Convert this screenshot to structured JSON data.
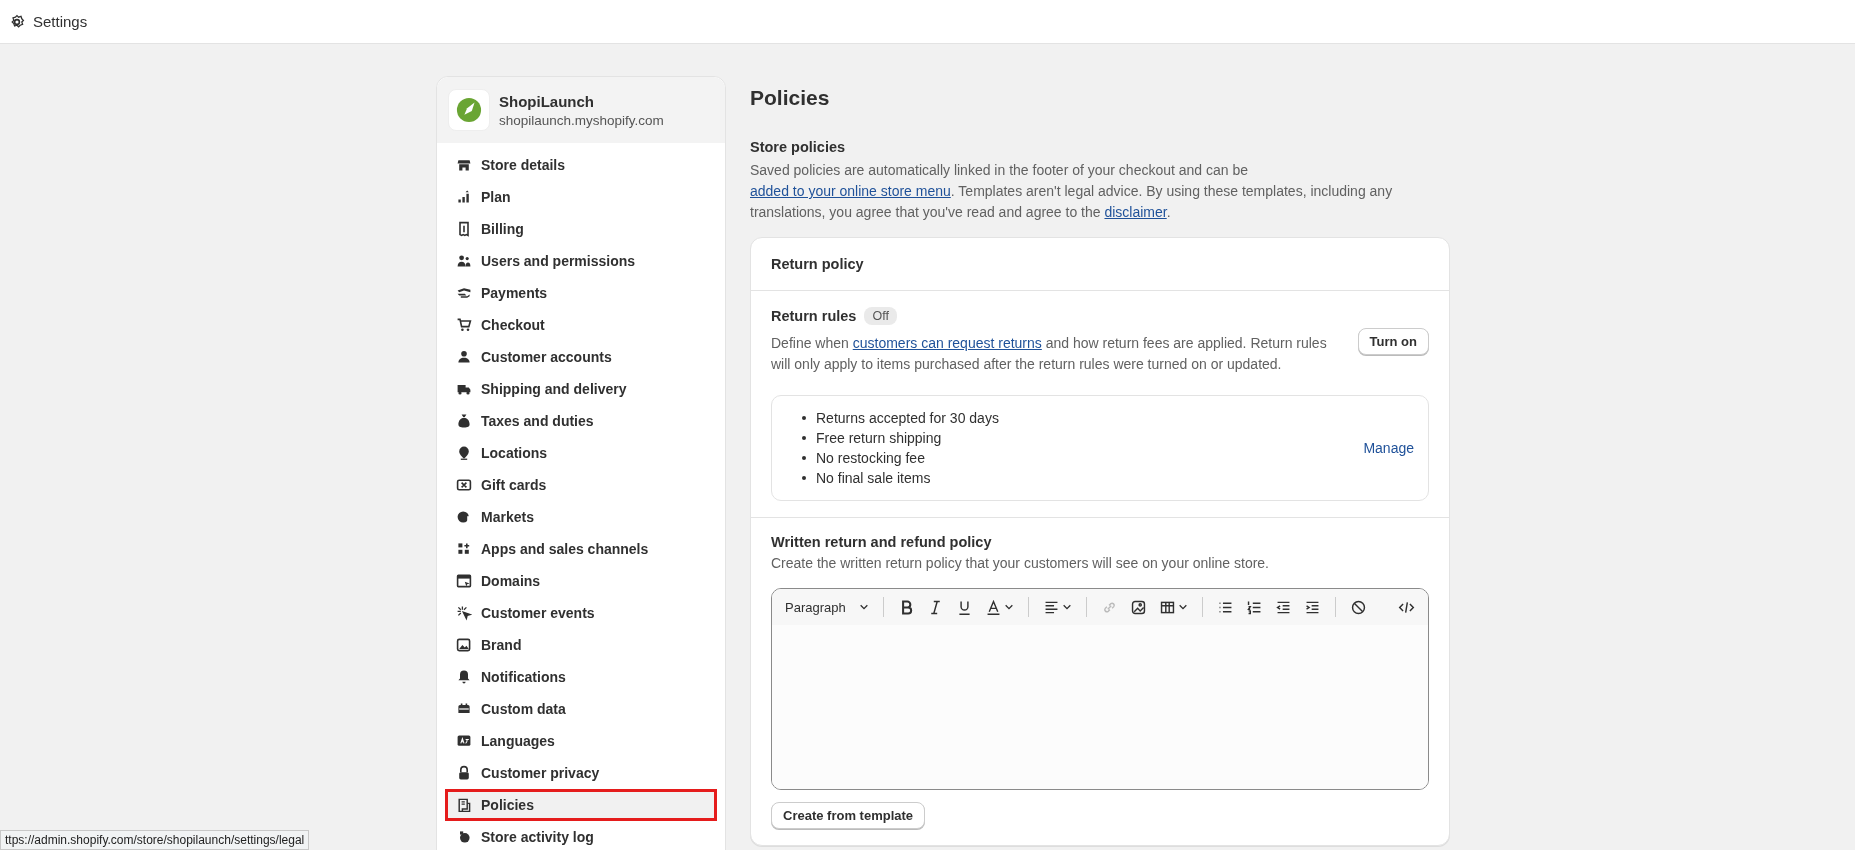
{
  "top_bar": {
    "title": "Settings"
  },
  "store": {
    "name": "ShopiLaunch",
    "domain": "shopilaunch.myshopify.com"
  },
  "sidebar": {
    "items": [
      {
        "label": "Store details",
        "selected": false,
        "highlighted": false
      },
      {
        "label": "Plan",
        "selected": false,
        "highlighted": false
      },
      {
        "label": "Billing",
        "selected": false,
        "highlighted": false
      },
      {
        "label": "Users and permissions",
        "selected": false,
        "highlighted": false
      },
      {
        "label": "Payments",
        "selected": false,
        "highlighted": false
      },
      {
        "label": "Checkout",
        "selected": false,
        "highlighted": false
      },
      {
        "label": "Customer accounts",
        "selected": false,
        "highlighted": false
      },
      {
        "label": "Shipping and delivery",
        "selected": false,
        "highlighted": false
      },
      {
        "label": "Taxes and duties",
        "selected": false,
        "highlighted": false
      },
      {
        "label": "Locations",
        "selected": false,
        "highlighted": false
      },
      {
        "label": "Gift cards",
        "selected": false,
        "highlighted": false
      },
      {
        "label": "Markets",
        "selected": false,
        "highlighted": false
      },
      {
        "label": "Apps and sales channels",
        "selected": false,
        "highlighted": false
      },
      {
        "label": "Domains",
        "selected": false,
        "highlighted": false
      },
      {
        "label": "Customer events",
        "selected": false,
        "highlighted": false
      },
      {
        "label": "Brand",
        "selected": false,
        "highlighted": false
      },
      {
        "label": "Notifications",
        "selected": false,
        "highlighted": false
      },
      {
        "label": "Custom data",
        "selected": false,
        "highlighted": false
      },
      {
        "label": "Languages",
        "selected": false,
        "highlighted": false
      },
      {
        "label": "Customer privacy",
        "selected": false,
        "highlighted": false
      },
      {
        "label": "Policies",
        "selected": true,
        "highlighted": true
      },
      {
        "label": "Store activity log",
        "selected": false,
        "highlighted": false
      }
    ]
  },
  "page": {
    "title": "Policies",
    "section_title": "Store policies",
    "intro": [
      {
        "text": "Saved policies are automatically linked in the footer of your checkout and can be ",
        "link": false
      },
      {
        "text": "added to your online store menu",
        "link": true
      },
      {
        "text": ". Templates aren't legal advice. By using these templates, including any translations, you agree that you've read and agree to the ",
        "link": false
      },
      {
        "text": "disclaimer",
        "link": true
      },
      {
        "text": ".",
        "link": false
      }
    ]
  },
  "return_policy": {
    "title": "Return policy",
    "rules": {
      "title": "Return rules",
      "badge": "Off",
      "on": false,
      "button": "Turn on",
      "description": [
        {
          "text": "Define when ",
          "link": false
        },
        {
          "text": "customers can request returns",
          "link": true
        },
        {
          "text": " and how return fees are applied. Return rules will only apply to items purchased after the return rules were turned on or updated.",
          "link": false
        }
      ],
      "items": [
        "Returns accepted for 30 days",
        "Free return shipping",
        "No restocking fee",
        "No final sale items"
      ],
      "manage": "Manage"
    },
    "written": {
      "title": "Written return and refund policy",
      "description": "Create the written return policy that your customers will see on your online store.",
      "format": "Paragraph",
      "button": "Create from template"
    }
  },
  "status_bar": {
    "url": "ttps://admin.shopify.com/store/shopilaunch/settings/legal"
  }
}
